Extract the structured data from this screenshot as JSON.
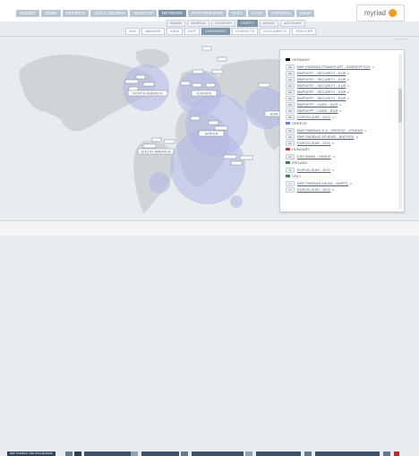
{
  "nav": {
    "items": [
      {
        "label": "SUBSET",
        "active": false
      },
      {
        "label": "DEMO",
        "active": false
      },
      {
        "label": "REPORTS",
        "active": false
      },
      {
        "label": "QUICK SEARCH",
        "active": false
      },
      {
        "label": "DESKTOP",
        "active": false
      },
      {
        "label": "NETWORK",
        "active": true
      },
      {
        "label": "PERFORMANCE",
        "active": false
      },
      {
        "label": "FEES",
        "active": false
      },
      {
        "label": "CASH",
        "active": false
      },
      {
        "label": "CONTROL",
        "active": false
      },
      {
        "label": "HELP",
        "active": false
      }
    ],
    "logo": "myriad"
  },
  "tabs": [
    {
      "label": "ADMIN",
      "active": false
    },
    {
      "label": "SEARCH",
      "active": false
    },
    {
      "label": "COUNTRY",
      "active": false
    },
    {
      "label": "ENTITY",
      "active": true
    },
    {
      "label": "AGENT",
      "active": false
    },
    {
      "label": "ACCOUNT",
      "active": false
    }
  ],
  "subtabs": [
    {
      "label": "ADD",
      "active": false
    },
    {
      "label": "MANAGE",
      "active": false
    },
    {
      "label": "VIEW",
      "active": false
    },
    {
      "label": "EDIT",
      "active": false
    },
    {
      "label": "COUNTRIES",
      "active": true
    },
    {
      "label": "CONTACTS",
      "active": false
    },
    {
      "label": "DOCUMENTS",
      "active": false
    },
    {
      "label": "TRACKER",
      "active": false
    }
  ],
  "filter": "FILTERS ▾",
  "map": {
    "regions": [
      {
        "label": "NORTH AMERICA"
      },
      {
        "label": "EUROPE"
      },
      {
        "label": "ASIA"
      },
      {
        "label": "AFRICA"
      },
      {
        "label": "SOUTH AMERICA"
      }
    ]
  },
  "panel": {
    "entries": [
      {
        "type": "country",
        "label": "GERMANY",
        "flag": "#000"
      },
      {
        "type": "item",
        "code": "DE",
        "label": "BNP PARIBAS FRANKFURT - BNPDEFFXXX"
      },
      {
        "type": "item",
        "code": "DE",
        "label": "BNPDEFF - SECURITY - EUR"
      },
      {
        "type": "item",
        "code": "DE",
        "label": "BNPDEFF - SECURITY - EUR"
      },
      {
        "type": "item",
        "code": "DE",
        "label": "BNPDEFF - SECURITY - EUR"
      },
      {
        "type": "item",
        "code": "DE",
        "label": "BNPDEFF - SECURITY - EUR"
      },
      {
        "type": "item",
        "code": "DE",
        "label": "BNPDEFF - SECURITY - EUR"
      },
      {
        "type": "item",
        "code": "DE",
        "label": "BNPDEFF - CASH - EUR"
      },
      {
        "type": "item",
        "code": "DE",
        "label": "BNPDEFF - CASH - EUR"
      },
      {
        "type": "item",
        "code": "DE",
        "label": "EUROCLEAR - DOC"
      },
      {
        "type": "country",
        "label": "GREECE",
        "flag": "#5c8bd6"
      },
      {
        "type": "item",
        "code": "GR",
        "label": "BNP PARIBAS S.A - GREECE - ATHENS"
      },
      {
        "type": "item",
        "code": "GR",
        "label": "BNP PARIBAS ATHENS - BNPGRX"
      },
      {
        "type": "item",
        "code": "GR",
        "label": "EUROCLEAR - DOC"
      },
      {
        "type": "country",
        "label": "HUNGARY",
        "flag": "#c33a3a"
      },
      {
        "type": "item",
        "code": "HU",
        "label": "KSH BANK - HXBUP"
      },
      {
        "type": "country",
        "label": "IRELAND",
        "flag": "#2f8f3e"
      },
      {
        "type": "item",
        "code": "IE",
        "label": "EUROCLEAR - DOC"
      },
      {
        "type": "country",
        "label": "ITALY",
        "flag": "#2f8f3e"
      },
      {
        "type": "item",
        "code": "IT",
        "label": "BNP PARIBAS MILAN - BNPITL"
      },
      {
        "type": "item",
        "code": "IT",
        "label": "EUROCLEAR - DOC"
      }
    ]
  },
  "footer": {
    "left": "BNP PARIBAS / DEUTSCHE BANK"
  }
}
